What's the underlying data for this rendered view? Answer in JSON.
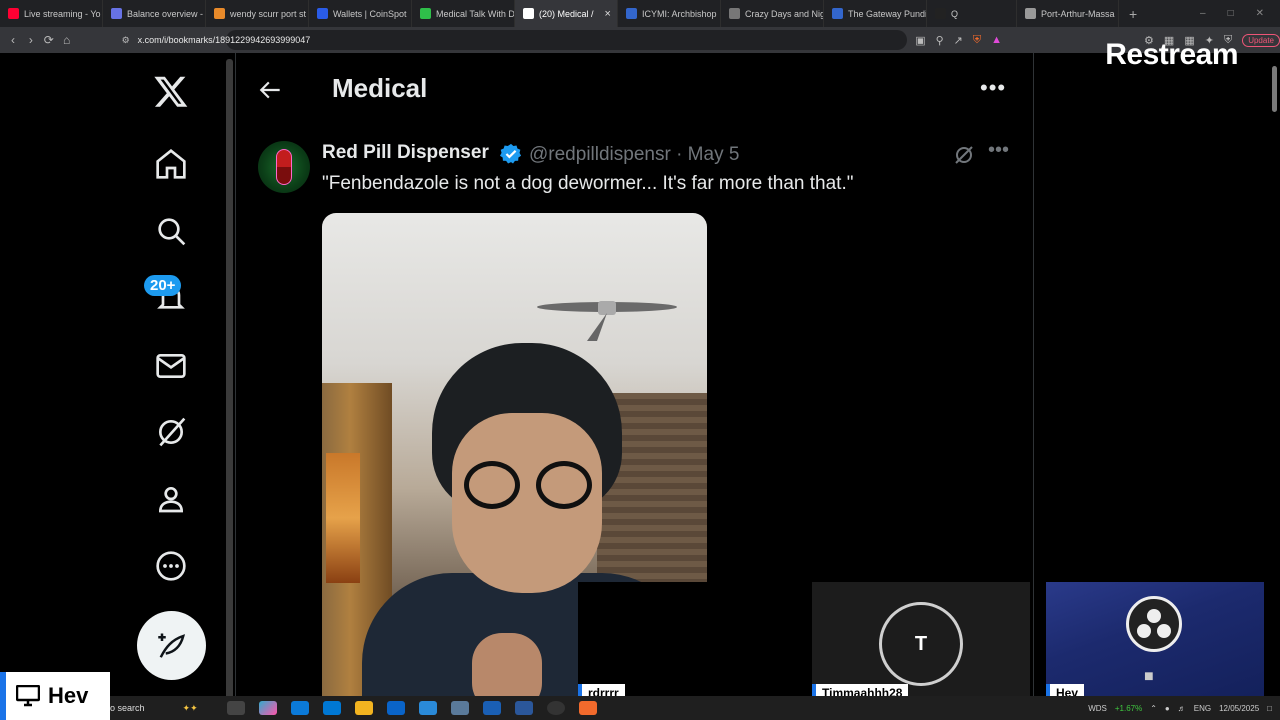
{
  "browser": {
    "tabs": [
      {
        "label": "Live streaming - Yo",
        "color": "#ff0033"
      },
      {
        "label": "Balance overview -",
        "color": "#6772e5"
      },
      {
        "label": "wendy scurr port st",
        "color": "#e88a2a"
      },
      {
        "label": "Wallets | CoinSpot",
        "color": "#2a5ce8"
      },
      {
        "label": "Medical Talk With D",
        "color": "#2fbf4a"
      },
      {
        "label": "(20) Medical /",
        "color": "#ffffff",
        "active": true
      },
      {
        "label": "ICYMI: Archbishop",
        "color": "#3366cc"
      },
      {
        "label": "Crazy Days and Nig",
        "color": "#777777"
      },
      {
        "label": "The Gateway Pundi",
        "color": "#3366cc"
      },
      {
        "label": "Q",
        "color": "#222222"
      },
      {
        "label": "Port-Arthur-Massa",
        "color": "#999999"
      }
    ],
    "url": "x.com/i/bookmarks/1891229942693999047",
    "update_label": "Update"
  },
  "overlay": {
    "brand": "Restream",
    "share_label": "Hev",
    "cams": [
      {
        "label": "rdrrrr"
      },
      {
        "label": "Timmaahhh28",
        "initial": "T"
      },
      {
        "label": "Hev"
      }
    ]
  },
  "x": {
    "notifications_badge": "20+",
    "page_title": "Medical",
    "tweet": {
      "name": "Red Pill Dispenser",
      "handle": "@redpilldispensr",
      "date": "· May 5",
      "text": "\"Fenbendazole is not a dog dewormer... It's far more than that.\""
    }
  },
  "taskbar": {
    "search_label": "o search",
    "tray_ticker": "WDS",
    "tray_change": "+1.67%",
    "tray_lang": "ENG",
    "date": "12/05/2025"
  }
}
